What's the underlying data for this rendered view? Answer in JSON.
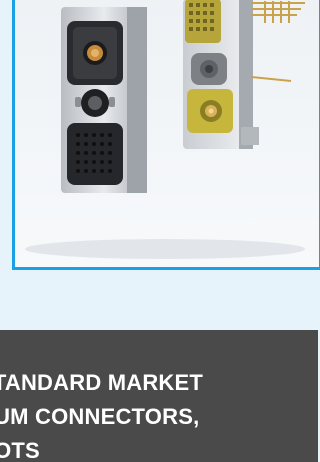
{
  "banner": {
    "title": "STANDARD MARKET\nDUM CONNECTORS,\nCOTS"
  },
  "image": {
    "alt": "rectangular connector products",
    "icon": "product-photo"
  },
  "colors": {
    "frame_border": "#19a0e6",
    "page_background": "#e6f3fb",
    "banner_background": "#4a4a4a",
    "banner_text": "#ffffff"
  }
}
